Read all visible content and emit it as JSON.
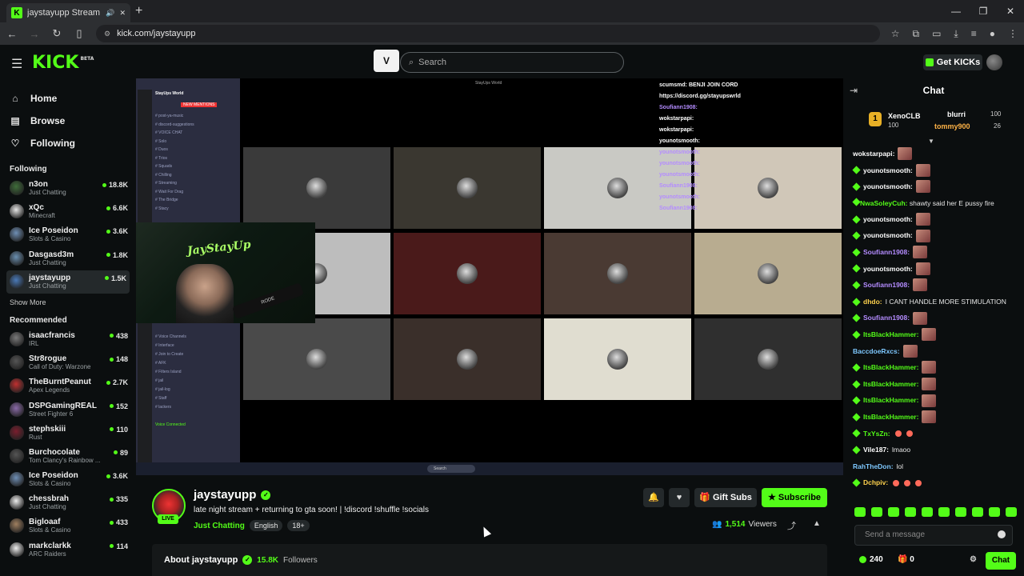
{
  "browser": {
    "tab_title": "jaystayupp Stream - Watch",
    "url": "kick.com/jaystayupp",
    "new_tab": "+",
    "win_min": "—",
    "win_max": "❐",
    "win_close": "✕"
  },
  "topnav": {
    "logo": "KICK",
    "beta": "BETA",
    "search_placeholder": "Search",
    "get_kicks": "Get KICKs"
  },
  "sidebar": {
    "nav": [
      {
        "label": "Home",
        "icon": "home-icon"
      },
      {
        "label": "Browse",
        "icon": "browse-icon"
      },
      {
        "label": "Following",
        "icon": "heart-icon"
      }
    ],
    "following_heading": "Following",
    "following": [
      {
        "name": "n3on",
        "category": "Just Chatting",
        "viewers": "18.8K",
        "color": "#3f6d3a"
      },
      {
        "name": "xQc",
        "category": "Minecraft",
        "viewers": "6.6K",
        "color": "#e6e6e6"
      },
      {
        "name": "Ice Poseidon",
        "category": "Slots & Casino",
        "viewers": "3.6K",
        "color": "#6f8fb5"
      },
      {
        "name": "Dasgasd3m",
        "category": "Just Chatting",
        "viewers": "1.8K",
        "color": "#6a8fb0"
      },
      {
        "name": "jaystayupp",
        "category": "Just Chatting",
        "viewers": "1.5K",
        "color": "#4a7ab8"
      }
    ],
    "show_more": "Show More",
    "recommended_heading": "Recommended",
    "recommended": [
      {
        "name": "isaacfrancis",
        "category": "IRL",
        "viewers": "438",
        "color": "#7a7a7a"
      },
      {
        "name": "Str8rogue",
        "category": "Call of Duty: Warzone",
        "viewers": "148",
        "color": "#555"
      },
      {
        "name": "TheBurntPeanut",
        "category": "Apex Legends",
        "viewers": "2.7K",
        "color": "#c03030"
      },
      {
        "name": "DSPGamingREAL",
        "category": "Street Fighter 6",
        "viewers": "152",
        "color": "#8a6aa8"
      },
      {
        "name": "stephskiii",
        "category": "Rust",
        "viewers": "110",
        "color": "#7a1e2e"
      },
      {
        "name": "Burchocolate",
        "category": "Tom Clancy's Rainbow ...",
        "viewers": "89",
        "color": "#555"
      },
      {
        "name": "Ice Poseidon",
        "category": "Slots & Casino",
        "viewers": "3.6K",
        "color": "#6f8fb5"
      },
      {
        "name": "chessbrah",
        "category": "Just Chatting",
        "viewers": "335",
        "color": "#eee"
      },
      {
        "name": "Bigloaaf",
        "category": "Slots & Casino",
        "viewers": "433",
        "color": "#a08060"
      },
      {
        "name": "markclarkk",
        "category": "ARC Raiders",
        "viewers": "114",
        "color": "#eee"
      }
    ]
  },
  "video": {
    "window_title": "StayUps World",
    "discord": {
      "server": "StayUps World",
      "channels": [
        "post-ya-music",
        "discord-suggestions",
        "VOICE CHAT",
        "Solo",
        "Duos",
        "Trios",
        "Squads",
        "Chilling",
        "Streaming",
        "Wait For Drag",
        "The Bridge",
        "Stacy"
      ],
      "lower_channels": [
        "Voice Channels",
        "Interface",
        "Join to Create",
        "AFK",
        "Filters Island",
        "jail",
        "jail-log",
        "Staff",
        "lackers"
      ],
      "voice_status": "Voice Connected",
      "mentions": "NEW MENTIONS"
    },
    "overlay_chat": [
      {
        "user": "scumsmd",
        "text": "BENJI JOIN CORD",
        "color": "#ffffff"
      },
      {
        "user": "",
        "text": "https://discord.gg/stayupswrld",
        "color": "#ffffff"
      },
      {
        "user": "Soufiann1908",
        "text": "",
        "color": "#b48cff"
      },
      {
        "user": "wokstarpapi",
        "text": "",
        "color": "#ffffff"
      },
      {
        "user": "wokstarpapi",
        "text": "",
        "color": "#ffffff"
      },
      {
        "user": "younotsmooth",
        "text": "",
        "color": "#ffffff"
      },
      {
        "user": "younotsmooth",
        "text": "",
        "color": "#b48cff"
      },
      {
        "user": "younotsmooth",
        "text": "",
        "color": "#b48cff"
      },
      {
        "user": "younotsmooth",
        "text": "",
        "color": "#b48cff"
      },
      {
        "user": "Soufiann1908",
        "text": "",
        "color": "#b48cff"
      },
      {
        "user": "younotsmooth",
        "text": "",
        "color": "#b48cff"
      },
      {
        "user": "Soufiann1908",
        "text": "",
        "color": "#b48cff"
      }
    ],
    "neon_sign": "JayStayUp",
    "mic_label": "RODE"
  },
  "stream": {
    "channel": "jaystayupp",
    "live_badge": "LIVE",
    "title": "late night stream + returning to gta soon! | !discord !shuffle !socials",
    "category": "Just Chatting",
    "tags": [
      "English",
      "18+"
    ],
    "gift_subs": "Gift Subs",
    "subscribe": "Subscribe",
    "viewers_count": "1,514",
    "viewers_label": "Viewers",
    "about_label": "About jaystayupp",
    "followers_count": "15.8K",
    "followers_label": "Followers"
  },
  "chat": {
    "title": "Chat",
    "leaderboard": [
      {
        "name": "XenoCLB",
        "value": "100"
      },
      {
        "name": "blurri",
        "value": "100"
      },
      {
        "name": "tommy900",
        "value": "26"
      }
    ],
    "messages": [
      {
        "user": "wokstarpapi",
        "text": "",
        "color": "#ffffff",
        "badge": false,
        "emote": true
      },
      {
        "user": "younotsmooth",
        "text": "",
        "color": "#ffffff",
        "badge": true,
        "emote": true
      },
      {
        "user": "younotsmooth",
        "text": "",
        "color": "#ffffff",
        "badge": true,
        "emote": true
      },
      {
        "user": "NwaSoleyCuh",
        "text": "shawty said her E pussy fire",
        "color": "#53fc18",
        "badge": true,
        "emote": false,
        "wrap": true
      },
      {
        "user": "younotsmooth",
        "text": "",
        "color": "#ffffff",
        "badge": true,
        "emote": true
      },
      {
        "user": "younotsmooth",
        "text": "",
        "color": "#ffffff",
        "badge": true,
        "emote": true
      },
      {
        "user": "Soufiann1908",
        "text": "",
        "color": "#b48cff",
        "badge": true,
        "emote": true
      },
      {
        "user": "younotsmooth",
        "text": "",
        "color": "#ffffff",
        "badge": true,
        "emote": true
      },
      {
        "user": "Soufiann1908",
        "text": "",
        "color": "#b48cff",
        "badge": true,
        "emote": true
      },
      {
        "user": "dhdo",
        "text": "I CANT HANDLE MORE STIMULATION",
        "color": "#ffd24d",
        "badge": true,
        "emote": false
      },
      {
        "user": "Soufiann1908",
        "text": "",
        "color": "#b48cff",
        "badge": true,
        "emote": true
      },
      {
        "user": "ItsBlackHammer",
        "text": "",
        "color": "#53fc18",
        "badge": true,
        "emote": true
      },
      {
        "user": "BaccdoeRxcs",
        "text": "",
        "color": "#7ec8ff",
        "badge": false,
        "emote": true
      },
      {
        "user": "ItsBlackHammer",
        "text": "",
        "color": "#53fc18",
        "badge": true,
        "emote": true
      },
      {
        "user": "ItsBlackHammer",
        "text": "",
        "color": "#53fc18",
        "badge": true,
        "emote": true
      },
      {
        "user": "ItsBlackHammer",
        "text": "",
        "color": "#53fc18",
        "badge": true,
        "emote": true
      },
      {
        "user": "ItsBlackHammer",
        "text": "",
        "color": "#53fc18",
        "badge": true,
        "emote": true
      },
      {
        "user": "TxYsZn",
        "text": "",
        "color": "#53fc18",
        "badge": true,
        "emote": false,
        "emojis": 2
      },
      {
        "user": "Vile187",
        "text": "lmaoo",
        "color": "#ffffff",
        "badge": true,
        "emote": false
      },
      {
        "user": "RahTheDon",
        "text": "lol",
        "color": "#7ec8ff",
        "badge": false,
        "emote": false
      },
      {
        "user": "Dchpiv",
        "text": "",
        "color": "#ffd24d",
        "badge": true,
        "emote": false,
        "emojis": 3
      }
    ],
    "input_placeholder": "Send a message",
    "points": "240",
    "gifts": "0",
    "chat_button": "Chat"
  },
  "colors": {
    "accent": "#53fc18",
    "background": "#0b0e0f",
    "surface": "#24292b"
  }
}
